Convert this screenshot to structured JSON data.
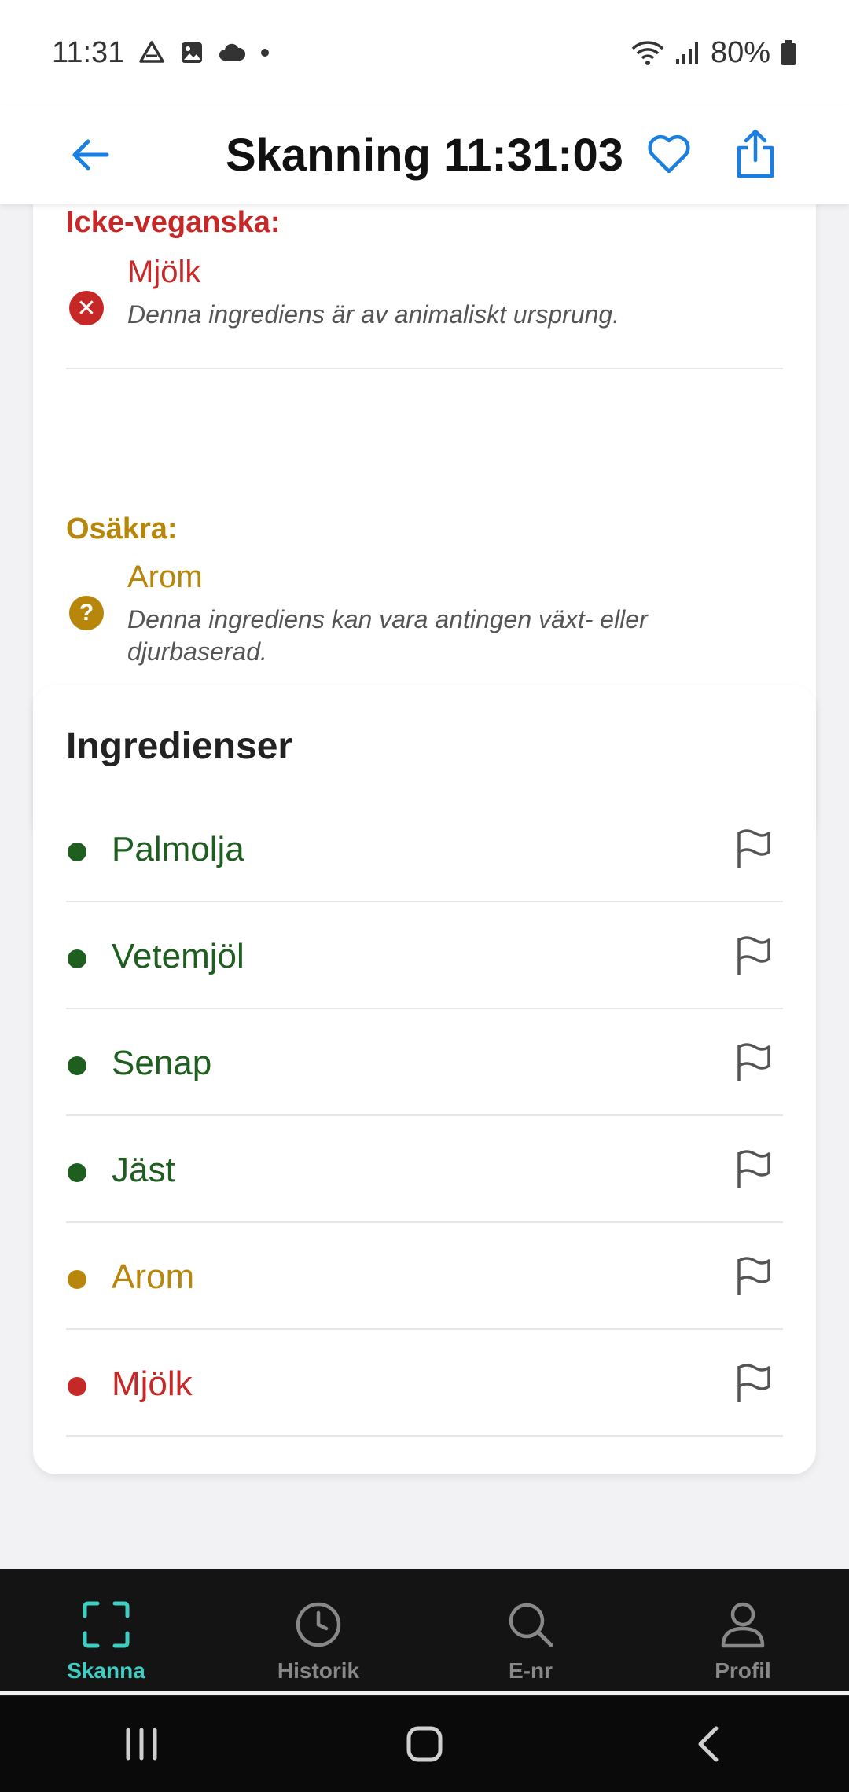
{
  "status_bar": {
    "time": "11:31",
    "battery": "80%",
    "icons": [
      "drive-icon",
      "gallery-icon",
      "cloud-icon",
      "dot-icon",
      "wifi-icon",
      "signal-icon",
      "battery-icon"
    ]
  },
  "header": {
    "title": "Skanning 11:31:03",
    "back_icon": "arrow-left-icon",
    "favorite_icon": "heart-icon",
    "share_icon": "share-icon"
  },
  "analysis": {
    "nonvegan_label": "Icke-veganska:",
    "nonvegan_items": [
      {
        "name": "Mjölk",
        "description": "Denna ingrediens är av animaliskt ursprung.",
        "icon": "x-circle-icon",
        "color": "#c62828"
      }
    ],
    "uncertain_label": "Osäkra:",
    "uncertain_items": [
      {
        "name": "Arom",
        "description": "Denna ingrediens kan vara antingen växt- eller djurbaserad.",
        "icon": "question-circle-icon",
        "color": "#b8860b"
      }
    ]
  },
  "ingredients": {
    "title": "Ingredienser",
    "items": [
      {
        "name": "Palmolja",
        "status": "vegan",
        "color": "#1e5e1e"
      },
      {
        "name": "Vetemjöl",
        "status": "vegan",
        "color": "#1e5e1e"
      },
      {
        "name": "Senap",
        "status": "vegan",
        "color": "#1e5e1e"
      },
      {
        "name": "Jäst",
        "status": "vegan",
        "color": "#1e5e1e"
      },
      {
        "name": "Arom",
        "status": "uncertain",
        "color": "#b8860b"
      },
      {
        "name": "Mjölk",
        "status": "nonvegan",
        "color": "#c62828"
      }
    ]
  },
  "bottom_nav": {
    "items": [
      {
        "label": "Skanna",
        "icon": "scan-icon",
        "active": true
      },
      {
        "label": "Historik",
        "icon": "clock-icon",
        "active": false
      },
      {
        "label": "E-nr",
        "icon": "search-icon",
        "active": false
      },
      {
        "label": "Profil",
        "icon": "user-icon",
        "active": false
      }
    ],
    "active_color": "#3ecfc4"
  },
  "system_nav": {
    "icons": [
      "recents-icon",
      "home-icon",
      "back-icon"
    ]
  }
}
